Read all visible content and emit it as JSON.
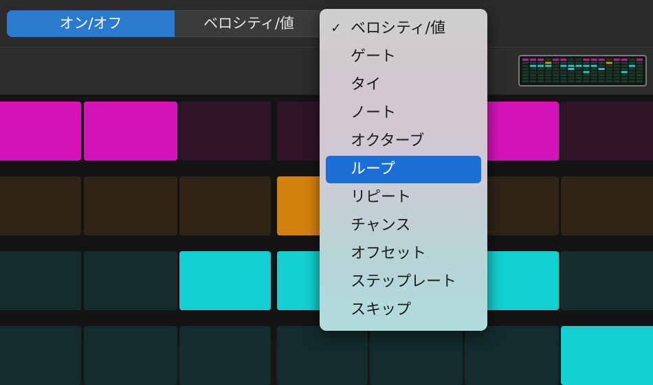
{
  "segmented": {
    "onoff_label": "オン/オフ",
    "velocity_label": "ベロシティ/値"
  },
  "colors": {
    "magenta_on": "#d414b8",
    "magenta_off": "#2f1428",
    "orange_on": "#d4820e",
    "orange_off": "#2f2416",
    "cyan_on": "#13cfcf",
    "cyan_off": "#142c2c",
    "accent": "#2a7bd0"
  },
  "menu": {
    "checked_mark": "✓",
    "items": [
      {
        "label": "ベロシティ/値",
        "checked": true
      },
      {
        "label": "ゲート"
      },
      {
        "label": "タイ"
      },
      {
        "label": "ノート"
      },
      {
        "label": "オクターブ"
      },
      {
        "label": "ループ",
        "highlighted": true
      },
      {
        "label": "リピート"
      },
      {
        "label": "チャンス"
      },
      {
        "label": "オフセット"
      },
      {
        "label": "ステップレート"
      },
      {
        "label": "スキップ"
      }
    ]
  },
  "step_rows": [
    {
      "color": "magenta",
      "steps": [
        true,
        true,
        false,
        false,
        false,
        true,
        false
      ]
    },
    {
      "color": "orange",
      "steps": [
        false,
        false,
        false,
        true,
        false,
        false,
        false
      ]
    },
    {
      "color": "cyan",
      "steps": [
        false,
        false,
        true,
        true,
        false,
        true,
        false
      ]
    },
    {
      "color": "cyan",
      "steps": [
        false,
        false,
        false,
        false,
        false,
        false,
        true
      ]
    }
  ]
}
